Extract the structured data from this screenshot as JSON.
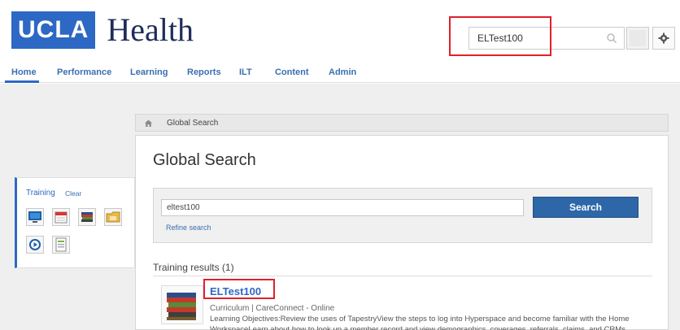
{
  "brand": {
    "logo_box": "UCLA",
    "logo_word": "Health"
  },
  "header": {
    "search_value": "ELTest100",
    "search_icon": "search-icon",
    "avatar_icon": "user-avatar",
    "settings_icon": "gear-icon"
  },
  "nav": {
    "items": [
      "Home",
      "Performance",
      "Learning",
      "Reports",
      "ILT",
      "Content",
      "Admin"
    ],
    "active": "Home"
  },
  "breadcrumb": {
    "icon": "home-icon",
    "label": "Global Search"
  },
  "page": {
    "title": "Global Search"
  },
  "search_panel": {
    "input_value": "eltest100",
    "button_label": "Search",
    "refine_label": "Refine search"
  },
  "results": {
    "heading": "Training results (1)",
    "items": [
      {
        "title": "ELTest100",
        "meta": "Curriculum | CareConnect - Online",
        "description": "Learning Objectives:Review the uses of TapestryView the steps to log into Hyperspace and become familiar with the Home WorkspaceLearn about how to look up a member record and view demographics, coverages, referrals, claims, and CRMs"
      }
    ]
  },
  "sidebar": {
    "title": "Training",
    "clear_label": "Clear",
    "tiles": [
      "monitor-icon",
      "calendar-icon",
      "books-icon",
      "folder-icon",
      "video-icon",
      "document-icon"
    ]
  },
  "colors": {
    "brand": "#2d68c4",
    "highlight": "#e0212b",
    "button": "#2d67a8"
  }
}
